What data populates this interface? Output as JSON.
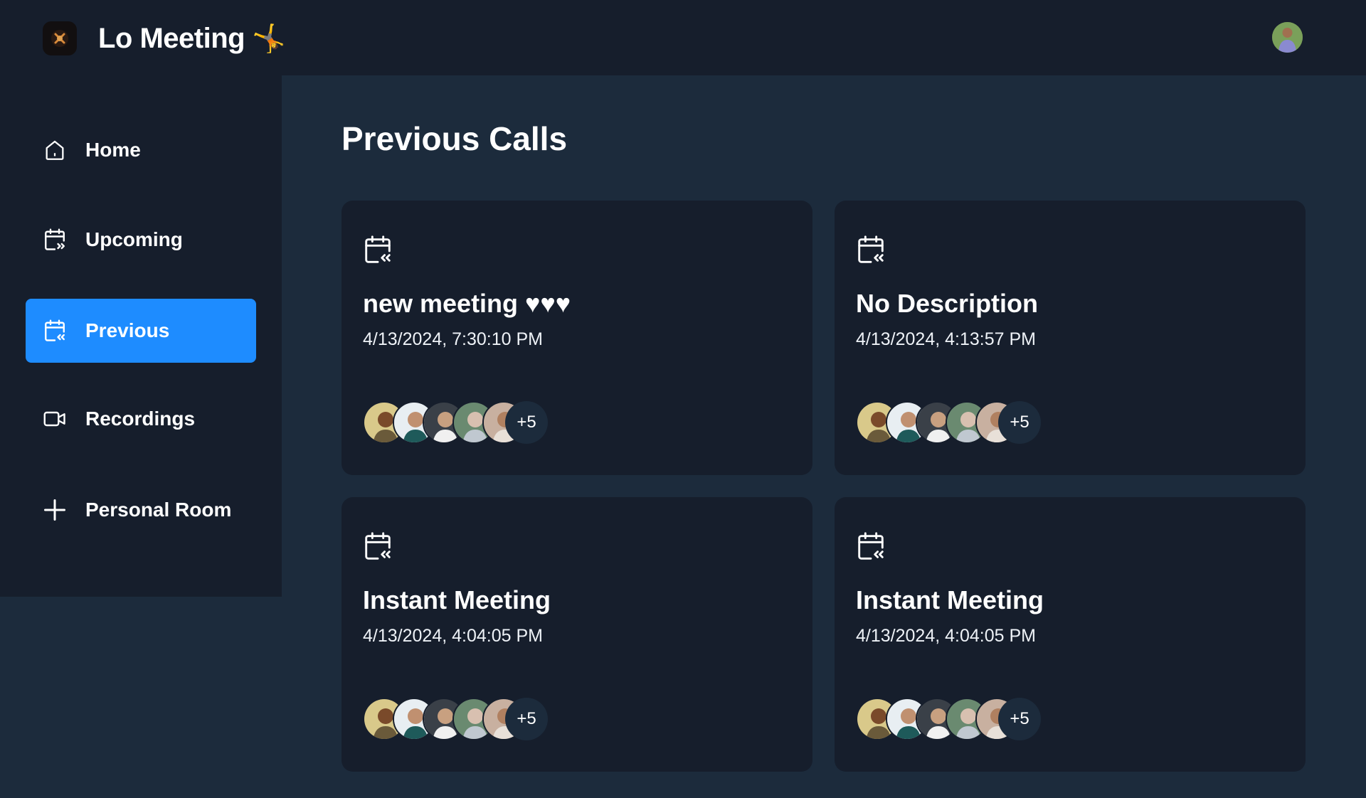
{
  "app": {
    "title": "Lo Meeting",
    "title_emoji": "🤸",
    "logo_icon": "logo-icon",
    "user_avatar_icon": "user-avatar"
  },
  "sidebar": {
    "items": [
      {
        "label": "Home",
        "icon": "home-icon",
        "active": false
      },
      {
        "label": "Upcoming",
        "icon": "calendar-forward-icon",
        "active": false
      },
      {
        "label": "Previous",
        "icon": "calendar-back-icon",
        "active": true
      },
      {
        "label": "Recordings",
        "icon": "video-icon",
        "active": false
      },
      {
        "label": "Personal Room",
        "icon": "plus-icon",
        "active": false
      }
    ]
  },
  "main": {
    "title": "Previous Calls",
    "cards": [
      {
        "title": "new meeting ♥♥♥",
        "date": "4/13/2024, 7:30:10 PM",
        "more_count": "+5"
      },
      {
        "title": "No Description",
        "date": "4/13/2024, 4:13:57 PM",
        "more_count": "+5"
      },
      {
        "title": "Instant Meeting",
        "date": "4/13/2024, 4:04:05 PM",
        "more_count": "+5"
      },
      {
        "title": "Instant Meeting",
        "date": "4/13/2024, 4:04:05 PM",
        "more_count": "+5"
      }
    ]
  },
  "colors": {
    "accent": "#1e8cff",
    "panel": "#161e2c",
    "background": "#1c2b3c"
  }
}
